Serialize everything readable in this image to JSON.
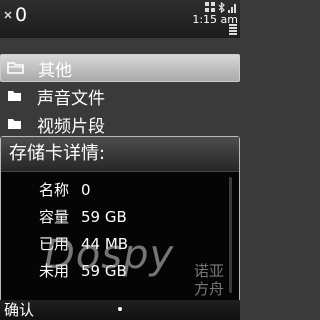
{
  "status_bar": {
    "folder_name": "0",
    "time": "1:15 am"
  },
  "list": {
    "items": [
      {
        "label": "其他",
        "icon": "folder-open-icon"
      },
      {
        "label": "声音文件",
        "icon": "folder-icon"
      },
      {
        "label": "视频片段",
        "icon": "folder-icon"
      }
    ]
  },
  "dialog": {
    "title": "存储卡详情:",
    "rows": [
      {
        "key": "名称",
        "value": "0"
      },
      {
        "key": "容量",
        "value": "59 GB"
      },
      {
        "key": "已用",
        "value": "44 MB"
      },
      {
        "key": "未用",
        "value": "59 GB"
      }
    ]
  },
  "softkeys": {
    "left": "确认"
  },
  "watermark": {
    "latin": "Dospy",
    "cn_line1": "诺亚",
    "cn_line2": "方舟"
  }
}
